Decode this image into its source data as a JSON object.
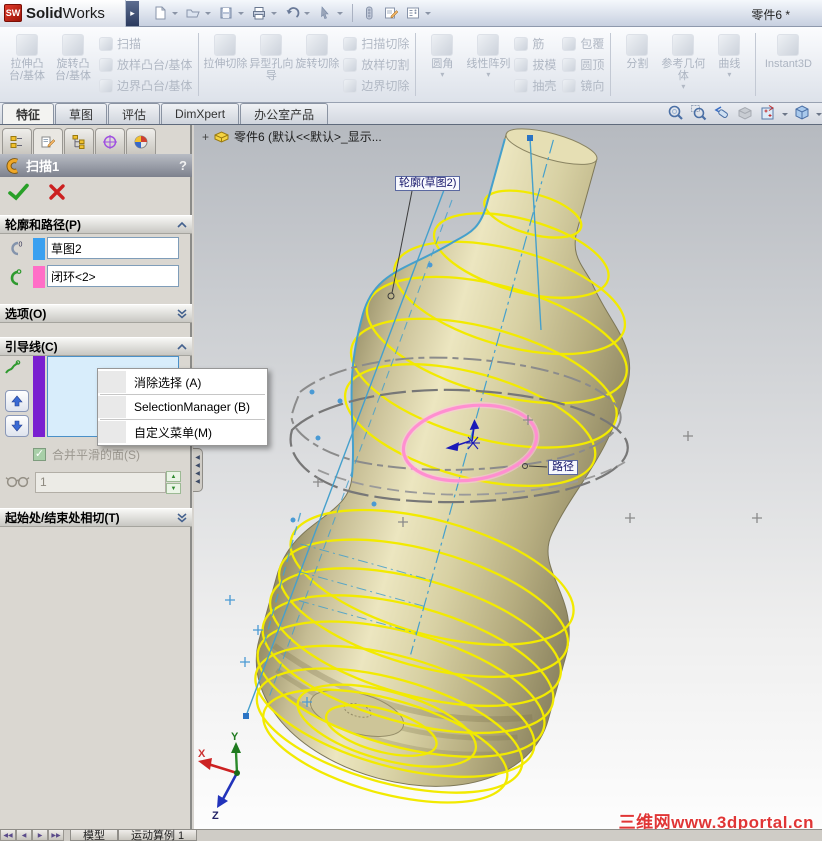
{
  "window": {
    "logo_sw": "SW",
    "app_bold": "Solid",
    "app_rest": "Works",
    "flyout_glyph": "▸",
    "doc_title": "零件6 *"
  },
  "features_toolbar": {
    "g1": {
      "b1": "拉伸凸台/基体",
      "b2": "旋转凸台/基体",
      "s1": "扫描",
      "s2": "放样凸台/基体",
      "s3": "边界凸台/基体"
    },
    "g2": {
      "b1": "拉伸切除",
      "b2": "异型孔向导",
      "b3": "旋转切除",
      "s1": "扫描切除",
      "s2": "放样切割",
      "s3": "边界切除"
    },
    "g3": {
      "b1": "圆角",
      "b2": "线性阵列",
      "s1": "筋",
      "s2": "拔模",
      "s3": "抽壳",
      "s4": "包覆",
      "s5": "圆顶",
      "s6": "镜向"
    },
    "g4": {
      "b1": "分割",
      "b2": "参考几何体",
      "b3": "曲线"
    },
    "g5": {
      "b1": "Instant3D"
    }
  },
  "mode_tabs": {
    "t1": "特征",
    "t2": "草图",
    "t3": "评估",
    "t4": "DimXpert",
    "t5": "办公室产品"
  },
  "property_manager": {
    "title": "扫描1",
    "help": "?",
    "profile_path": {
      "header": "轮廓和路径(P)",
      "profile_value": "草图2",
      "path_value": "闭环<2>"
    },
    "options": {
      "header": "选项(O)"
    },
    "guide_curves": {
      "header": "引导线(C)",
      "merge_smooth_label": "合并平滑的面(S)",
      "instance_value": "1",
      "check_glyph": "✓"
    },
    "tangency": {
      "header": "起始处/结束处相切(T)"
    }
  },
  "context_menu": {
    "item1": "消除选择 (A)",
    "item2": "SelectionManager (B)",
    "item3": "自定义菜单(M)"
  },
  "graphics": {
    "tree_expand": "+",
    "tree_root": "零件6 (默认<<默认>_显示...",
    "callout_profile": "轮廓(草图2)",
    "callout_path": "路径",
    "axis_x": "X",
    "axis_y": "Y",
    "axis_z": "Z",
    "watermark": "三维网www.3dportal.cn"
  },
  "status_bar": {
    "nav1": "◀◀",
    "nav2": "◀",
    "nav3": "▶",
    "nav4": "▶▶",
    "tab_model": "模型",
    "tab_motion": "运动算例 1"
  },
  "colors": {
    "bottle": "#d8d0a2",
    "coil_yellow": "#f2ea00",
    "path_pink": "#ff8fd0",
    "sketch_blue": "#3d9ad1",
    "swatch_blue": "#3aa0f0",
    "swatch_pink": "#ff6ec7",
    "swatch_purple": "#7a1fd0",
    "watermark_red": "#e03636"
  }
}
